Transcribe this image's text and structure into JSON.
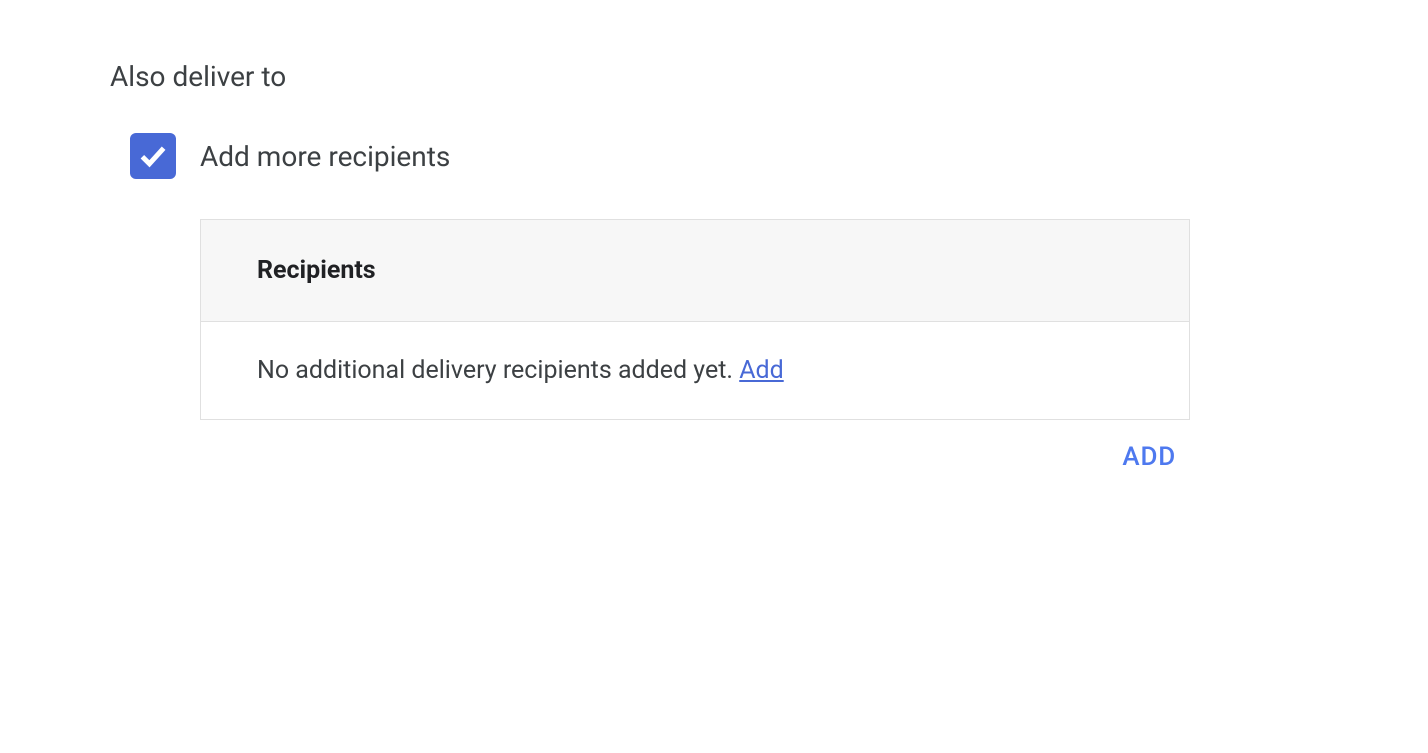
{
  "section": {
    "heading": "Also deliver to"
  },
  "checkbox": {
    "checked": true,
    "label": "Add more recipients"
  },
  "recipients": {
    "header": "Recipients",
    "empty_message": "No additional delivery recipients added yet. ",
    "inline_add_label": "Add"
  },
  "footer": {
    "add_button_label": "ADD"
  },
  "colors": {
    "checkbox_bg": "#4869d6",
    "link": "#4869d6",
    "button": "#4e79ef",
    "border": "#e0e0e0",
    "header_bg": "#f7f7f7",
    "text": "#3c4043"
  }
}
